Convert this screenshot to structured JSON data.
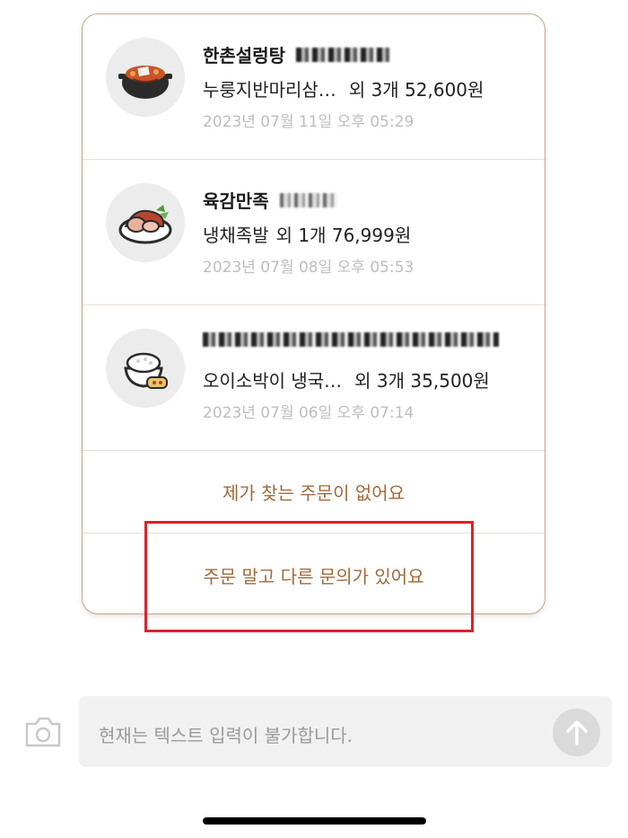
{
  "orders": [
    {
      "store": "한촌설렁탕",
      "summary_name": "누룽지반마리삼…",
      "summary_rest": "외 3개 52,600원",
      "date": "2023년 07월 11일 오후 05:29",
      "icon": "stew-pot-icon"
    },
    {
      "store": "육감만족",
      "summary_name": "냉채족발",
      "summary_rest": "외 1개 76,999원",
      "date": "2023년 07월 08일 오후 05:53",
      "icon": "pork-dish-icon"
    },
    {
      "store": "",
      "summary_name": "오이소박이 냉국…",
      "summary_rest": "외 3개 35,500원",
      "date": "2023년 07월 06일 오후 07:14",
      "icon": "rice-bowl-icon"
    }
  ],
  "options": {
    "not_found": "제가 찾는 주문이 없어요",
    "other_inquiry": "주문 말고 다른 문의가 있어요"
  },
  "input": {
    "placeholder": "현재는 텍스트 입력이 불가합니다."
  },
  "colors": {
    "accent": "#a16a3b",
    "card_border": "#c9a887",
    "highlight": "#e0202a"
  }
}
